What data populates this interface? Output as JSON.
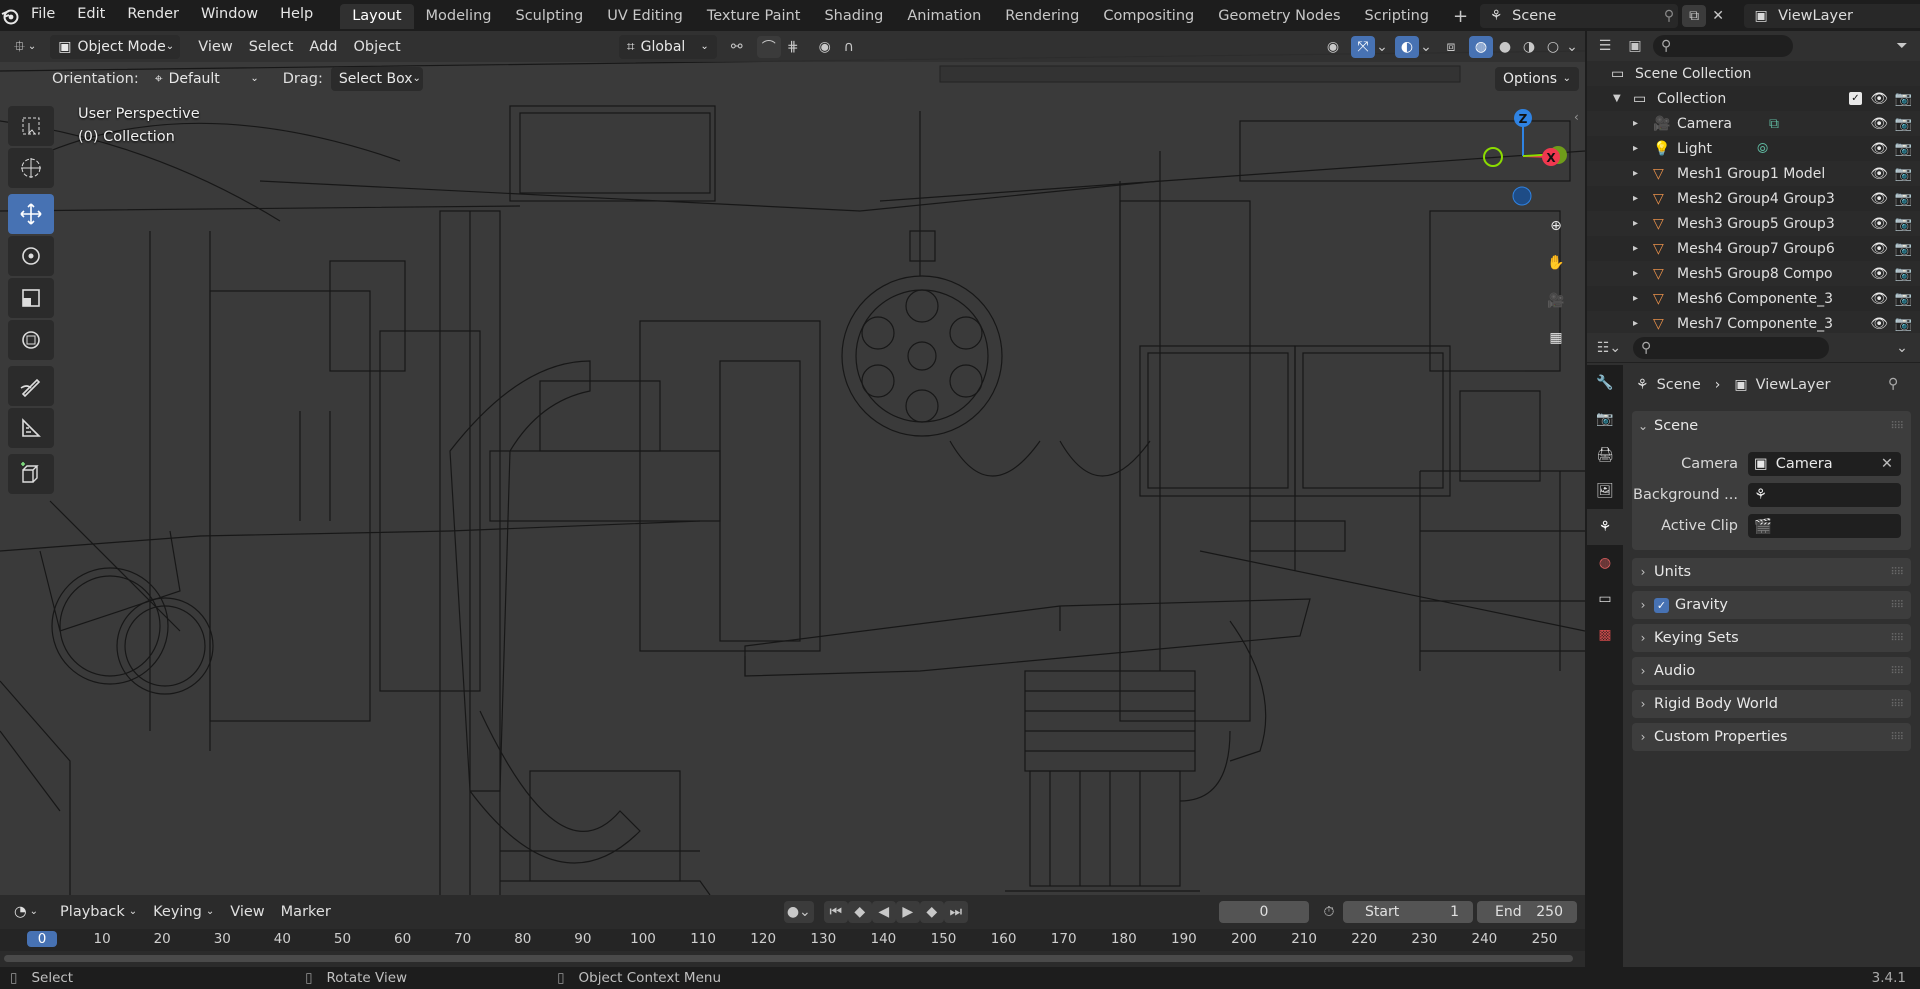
{
  "topbar": {
    "menus": [
      "File",
      "Edit",
      "Render",
      "Window",
      "Help"
    ],
    "workspaces": [
      "Layout",
      "Modeling",
      "Sculpting",
      "UV Editing",
      "Texture Paint",
      "Shading",
      "Animation",
      "Rendering",
      "Compositing",
      "Geometry Nodes",
      "Scripting"
    ],
    "active_workspace": "Layout",
    "add_tab": "+",
    "scene_name": "Scene",
    "view_layer_name": "ViewLayer"
  },
  "viewport": {
    "mode": "Object Mode",
    "menus": [
      "View",
      "Select",
      "Add",
      "Object"
    ],
    "transform_orientation": "Global",
    "orientation_label": "Orientation:",
    "orientation_value": "Default",
    "drag_label": "Drag:",
    "drag_value": "Select Box",
    "options_label": "Options",
    "overlay_title": "User Perspective",
    "overlay_collection": "(0) Collection",
    "gizmo": {
      "z": "Z",
      "x": "X",
      "y": "Y"
    }
  },
  "outliner": {
    "root": "Scene Collection",
    "collection": "Collection",
    "items": [
      {
        "label": "Camera",
        "type": "camera"
      },
      {
        "label": "Light",
        "type": "light"
      },
      {
        "label": "Mesh1 Group1 Model",
        "type": "mesh"
      },
      {
        "label": "Mesh2 Group4 Group3",
        "type": "mesh"
      },
      {
        "label": "Mesh3 Group5 Group3",
        "type": "mesh"
      },
      {
        "label": "Mesh4 Group7 Group6",
        "type": "mesh"
      },
      {
        "label": "Mesh5 Group8 Compo",
        "type": "mesh"
      },
      {
        "label": "Mesh6 Componente_3",
        "type": "mesh"
      },
      {
        "label": "Mesh7 Componente_3",
        "type": "mesh"
      }
    ]
  },
  "properties": {
    "breadcrumb_scene": "Scene",
    "breadcrumb_viewlayer": "ViewLayer",
    "scene_panel": "Scene",
    "camera_label": "Camera",
    "camera_value": "Camera",
    "background_label": "Background ...",
    "active_clip_label": "Active Clip",
    "panels": [
      "Units",
      "Gravity",
      "Keying Sets",
      "Audio",
      "Rigid Body World",
      "Custom Properties"
    ],
    "gravity_checked": true
  },
  "timeline": {
    "menus": [
      "Playback",
      "Keying",
      "View",
      "Marker"
    ],
    "current_frame": "0",
    "start_label": "Start",
    "start_value": "1",
    "end_label": "End",
    "end_value": "250",
    "ruler": [
      "0",
      "10",
      "20",
      "30",
      "40",
      "50",
      "60",
      "70",
      "80",
      "90",
      "100",
      "110",
      "120",
      "130",
      "140",
      "150",
      "160",
      "170",
      "180",
      "190",
      "200",
      "210",
      "220",
      "230",
      "240",
      "250"
    ]
  },
  "statusbar": {
    "select": "Select",
    "rotate": "Rotate View",
    "context": "Object Context Menu",
    "version": "3.4.1"
  },
  "colors": {
    "accent": "#4772b3",
    "x_axis": "#f0384f",
    "y_axis": "#8bdc00",
    "z_axis": "#2f83e3"
  }
}
